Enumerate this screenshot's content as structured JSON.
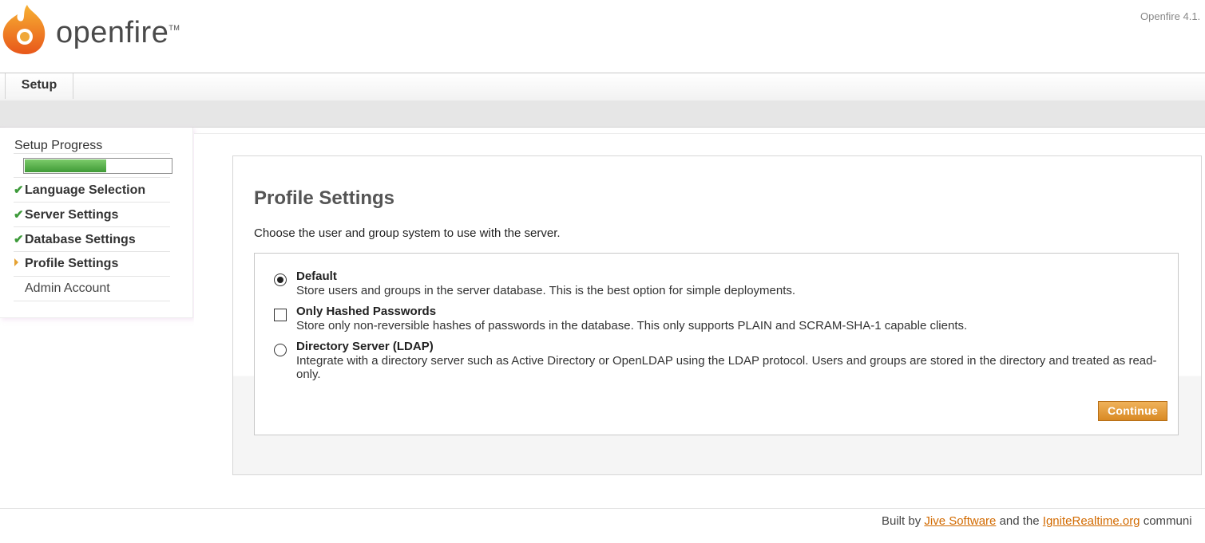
{
  "header": {
    "logo_text": "openfire",
    "logo_tm": "TM",
    "version": "Openfire 4.1."
  },
  "tabs": [
    {
      "label": "Setup"
    }
  ],
  "sidebar": {
    "title": "Setup Progress",
    "progress_fraction": 0.6,
    "steps": [
      {
        "label": "Language Selection",
        "status": "done"
      },
      {
        "label": "Server Settings",
        "status": "done"
      },
      {
        "label": "Database Settings",
        "status": "done"
      },
      {
        "label": "Profile Settings",
        "status": "current"
      },
      {
        "label": "Admin Account",
        "status": "pending"
      }
    ]
  },
  "main": {
    "title": "Profile Settings",
    "intro": "Choose the user and group system to use with the server.",
    "options": [
      {
        "title": "Default",
        "description": "Store users and groups in the server database. This is the best option for simple deployments.",
        "control": "radio",
        "checked": true
      },
      {
        "title": "Only Hashed Passwords",
        "description": "Store only non-reversible hashes of passwords in the database. This only supports PLAIN and SCRAM-SHA-1 capable clients.",
        "control": "checkbox",
        "checked": false
      },
      {
        "title": "Directory Server (LDAP)",
        "description": "Integrate with a directory server such as Active Directory or OpenLDAP using the LDAP protocol. Users and groups are stored in the directory and treated as read-only.",
        "control": "radio",
        "checked": false
      }
    ],
    "continue_label": "Continue"
  },
  "footer": {
    "prefix": "Built by ",
    "link1": "Jive Software",
    "middle": " and the ",
    "link2": "IgniteRealtime.org",
    "suffix": " communi"
  },
  "colors": {
    "accent": "#d26a00",
    "progress": "#4caf3e",
    "button": "#e09a3a"
  }
}
